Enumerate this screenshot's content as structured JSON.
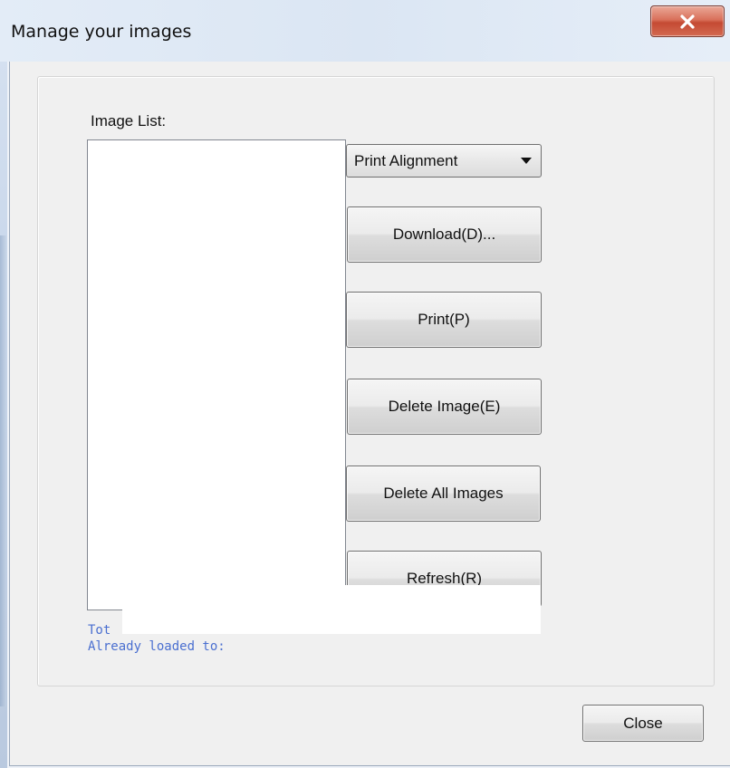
{
  "window": {
    "title": "Manage your images",
    "close_icon": "close-x-icon",
    "accent_close": "#c8503a"
  },
  "image_list": {
    "label": "Image List:",
    "items": []
  },
  "alignment_select": {
    "selected": "Print Alignment",
    "icon": "chevron-down-icon"
  },
  "buttons": {
    "download": "Download(D)...",
    "print": "Print(P)",
    "delete_image": "Delete Image(E)",
    "delete_all": "Delete All Images",
    "refresh": "Refresh(R)",
    "close": "Close"
  },
  "status": {
    "total_text": "Tot",
    "loaded_text": "Already loaded to:"
  },
  "colors": {
    "status_text": "#4a6fd0",
    "dialog_bg": "#f0f0f0"
  }
}
